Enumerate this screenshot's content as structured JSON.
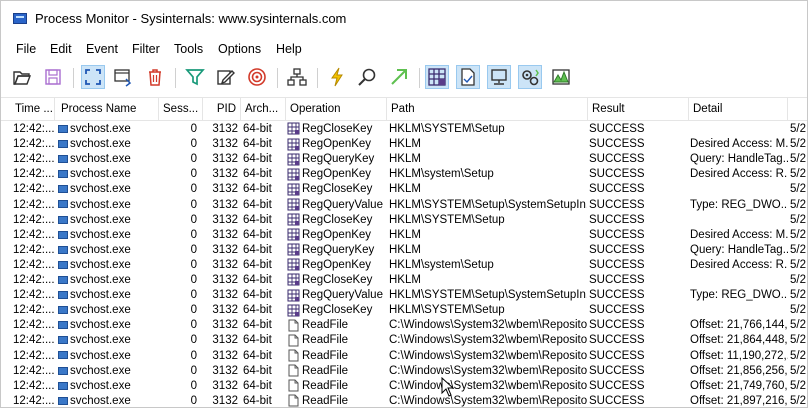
{
  "window": {
    "title": "Process Monitor - Sysinternals: www.sysinternals.com"
  },
  "menu": [
    "File",
    "Edit",
    "Event",
    "Filter",
    "Tools",
    "Options",
    "Help"
  ],
  "toolbar": {
    "buttons": [
      {
        "name": "open-icon"
      },
      {
        "name": "save-icon"
      },
      {
        "name": "autoscroll-icon",
        "pressed": true
      },
      {
        "name": "capture-icon"
      },
      {
        "name": "clear-icon"
      },
      {
        "name": "filter-icon"
      },
      {
        "name": "highlight-icon"
      },
      {
        "name": "include-process-icon"
      },
      {
        "name": "process-tree-icon"
      },
      {
        "name": "event-properties-icon"
      },
      {
        "name": "find-icon"
      },
      {
        "name": "jump-icon"
      },
      {
        "name": "registry-activity-icon",
        "pressed": true
      },
      {
        "name": "file-activity-icon",
        "pressed": true
      },
      {
        "name": "network-activity-icon",
        "pressed": true
      },
      {
        "name": "process-activity-icon",
        "pressed": true
      },
      {
        "name": "profiling-icon"
      }
    ]
  },
  "columns": [
    "Time ...",
    "Process Name",
    "Sess...",
    "PID",
    "Arch...",
    "Operation",
    "Path",
    "Result",
    "Detail",
    ""
  ],
  "rows": [
    {
      "time": "12:42:...",
      "process": "svchost.exe",
      "session": "0",
      "pid": "3132",
      "arch": "64-bit",
      "op": "RegCloseKey",
      "opType": "reg",
      "path": "HKLM\\SYSTEM\\Setup",
      "result": "SUCCESS",
      "detail": "",
      "date": "5/2"
    },
    {
      "time": "12:42:...",
      "process": "svchost.exe",
      "session": "0",
      "pid": "3132",
      "arch": "64-bit",
      "op": "RegOpenKey",
      "opType": "reg",
      "path": "HKLM",
      "result": "SUCCESS",
      "detail": "Desired Access: M...",
      "date": "5/2"
    },
    {
      "time": "12:42:...",
      "process": "svchost.exe",
      "session": "0",
      "pid": "3132",
      "arch": "64-bit",
      "op": "RegQueryKey",
      "opType": "reg",
      "path": "HKLM",
      "result": "SUCCESS",
      "detail": "Query: HandleTag...",
      "date": "5/2"
    },
    {
      "time": "12:42:...",
      "process": "svchost.exe",
      "session": "0",
      "pid": "3132",
      "arch": "64-bit",
      "op": "RegOpenKey",
      "opType": "reg",
      "path": "HKLM\\system\\Setup",
      "result": "SUCCESS",
      "detail": "Desired Access: R...",
      "date": "5/2"
    },
    {
      "time": "12:42:...",
      "process": "svchost.exe",
      "session": "0",
      "pid": "3132",
      "arch": "64-bit",
      "op": "RegCloseKey",
      "opType": "reg",
      "path": "HKLM",
      "result": "SUCCESS",
      "detail": "",
      "date": "5/2"
    },
    {
      "time": "12:42:...",
      "process": "svchost.exe",
      "session": "0",
      "pid": "3132",
      "arch": "64-bit",
      "op": "RegQueryValue",
      "opType": "reg",
      "path": "HKLM\\SYSTEM\\Setup\\SystemSetupIn...",
      "result": "SUCCESS",
      "detail": "Type: REG_DWO...",
      "date": "5/2"
    },
    {
      "time": "12:42:...",
      "process": "svchost.exe",
      "session": "0",
      "pid": "3132",
      "arch": "64-bit",
      "op": "RegCloseKey",
      "opType": "reg",
      "path": "HKLM\\SYSTEM\\Setup",
      "result": "SUCCESS",
      "detail": "",
      "date": "5/2"
    },
    {
      "time": "12:42:...",
      "process": "svchost.exe",
      "session": "0",
      "pid": "3132",
      "arch": "64-bit",
      "op": "RegOpenKey",
      "opType": "reg",
      "path": "HKLM",
      "result": "SUCCESS",
      "detail": "Desired Access: M...",
      "date": "5/2"
    },
    {
      "time": "12:42:...",
      "process": "svchost.exe",
      "session": "0",
      "pid": "3132",
      "arch": "64-bit",
      "op": "RegQueryKey",
      "opType": "reg",
      "path": "HKLM",
      "result": "SUCCESS",
      "detail": "Query: HandleTag...",
      "date": "5/2"
    },
    {
      "time": "12:42:...",
      "process": "svchost.exe",
      "session": "0",
      "pid": "3132",
      "arch": "64-bit",
      "op": "RegOpenKey",
      "opType": "reg",
      "path": "HKLM\\system\\Setup",
      "result": "SUCCESS",
      "detail": "Desired Access: R...",
      "date": "5/2"
    },
    {
      "time": "12:42:...",
      "process": "svchost.exe",
      "session": "0",
      "pid": "3132",
      "arch": "64-bit",
      "op": "RegCloseKey",
      "opType": "reg",
      "path": "HKLM",
      "result": "SUCCESS",
      "detail": "",
      "date": "5/2"
    },
    {
      "time": "12:42:...",
      "process": "svchost.exe",
      "session": "0",
      "pid": "3132",
      "arch": "64-bit",
      "op": "RegQueryValue",
      "opType": "reg",
      "path": "HKLM\\SYSTEM\\Setup\\SystemSetupIn...",
      "result": "SUCCESS",
      "detail": "Type: REG_DWO...",
      "date": "5/2"
    },
    {
      "time": "12:42:...",
      "process": "svchost.exe",
      "session": "0",
      "pid": "3132",
      "arch": "64-bit",
      "op": "RegCloseKey",
      "opType": "reg",
      "path": "HKLM\\SYSTEM\\Setup",
      "result": "SUCCESS",
      "detail": "",
      "date": "5/2"
    },
    {
      "time": "12:42:...",
      "process": "svchost.exe",
      "session": "0",
      "pid": "3132",
      "arch": "64-bit",
      "op": "ReadFile",
      "opType": "file",
      "path": "C:\\Windows\\System32\\wbem\\Reposito...",
      "result": "SUCCESS",
      "detail": "Offset: 21,766,144,...",
      "date": "5/2"
    },
    {
      "time": "12:42:...",
      "process": "svchost.exe",
      "session": "0",
      "pid": "3132",
      "arch": "64-bit",
      "op": "ReadFile",
      "opType": "file",
      "path": "C:\\Windows\\System32\\wbem\\Reposito...",
      "result": "SUCCESS",
      "detail": "Offset: 21,864,448,...",
      "date": "5/2"
    },
    {
      "time": "12:42:...",
      "process": "svchost.exe",
      "session": "0",
      "pid": "3132",
      "arch": "64-bit",
      "op": "ReadFile",
      "opType": "file",
      "path": "C:\\Windows\\System32\\wbem\\Reposito...",
      "result": "SUCCESS",
      "detail": "Offset: 11,190,272,...",
      "date": "5/2"
    },
    {
      "time": "12:42:...",
      "process": "svchost.exe",
      "session": "0",
      "pid": "3132",
      "arch": "64-bit",
      "op": "ReadFile",
      "opType": "file",
      "path": "C:\\Windows\\System32\\wbem\\Reposito...",
      "result": "SUCCESS",
      "detail": "Offset: 21,856,256,...",
      "date": "5/2"
    },
    {
      "time": "12:42:...",
      "process": "svchost.exe",
      "session": "0",
      "pid": "3132",
      "arch": "64-bit",
      "op": "ReadFile",
      "opType": "file",
      "path": "C:\\Windows\\System32\\wbem\\Reposito...",
      "result": "SUCCESS",
      "detail": "Offset: 21,749,760,...",
      "date": "5/2"
    },
    {
      "time": "12:42:...",
      "process": "svchost.exe",
      "session": "0",
      "pid": "3132",
      "arch": "64-bit",
      "op": "ReadFile",
      "opType": "file",
      "path": "C:\\Windows\\System32\\wbem\\Reposito...",
      "result": "SUCCESS",
      "detail": "Offset: 21,897,216,...",
      "date": "5/2"
    }
  ],
  "colors": {
    "pressed_bg": "#cce4f7",
    "accent_blue": "#1e56b4",
    "reg_icon": "#5a3c8a"
  }
}
